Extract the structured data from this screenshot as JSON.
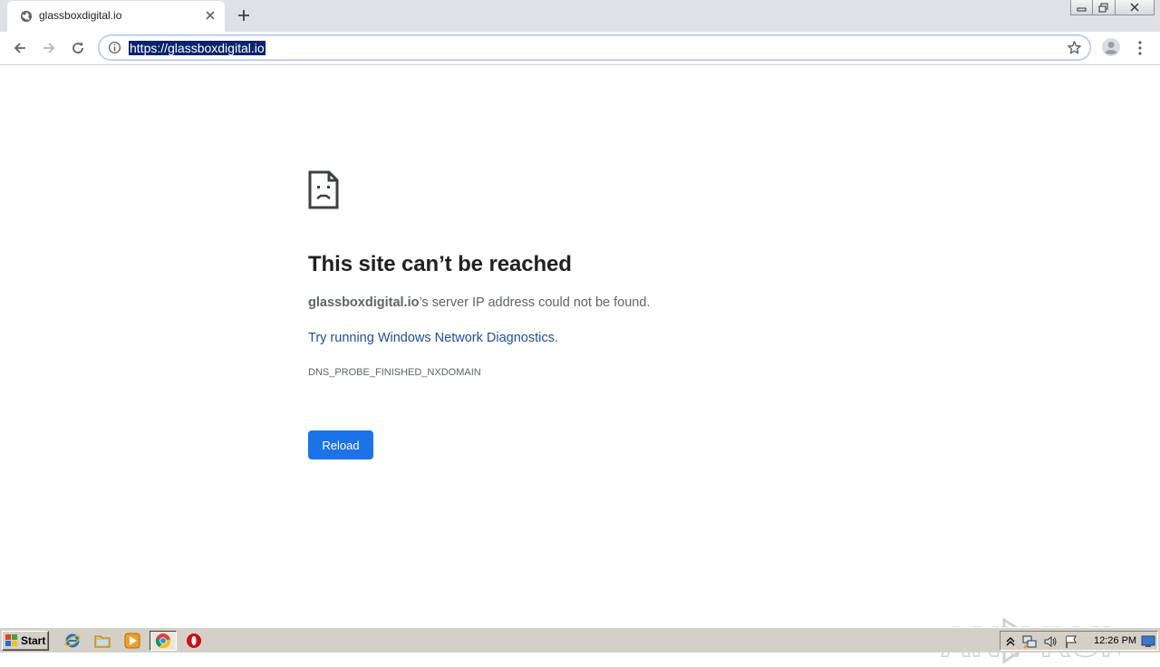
{
  "browser": {
    "tab": {
      "title": "glassboxdigital.io",
      "favicon": "globe-icon"
    },
    "omnibox": {
      "url": "https://glassboxdigital.io",
      "selected": true
    },
    "window_controls": [
      "minimize-icon",
      "restore-icon",
      "close-icon"
    ]
  },
  "error_page": {
    "heading": "This site can’t be reached",
    "host": "glassboxdigital.io",
    "description_suffix": "’s server IP address could not be found.",
    "diagnostics_link": "Try running Windows Network Diagnostics",
    "diagnostics_link_end": ".",
    "error_code": "DNS_PROBE_FINISHED_NXDOMAIN",
    "reload_label": "Reload",
    "accent_color": "#1a73e8"
  },
  "watermark": {
    "text": "ANY RUN"
  },
  "taskbar": {
    "start_label": "Start",
    "pinned": [
      "internet-explorer-icon",
      "folder-icon",
      "media-player-icon",
      "chrome-icon",
      "opera-icon"
    ],
    "tray": [
      "show-hidden-icons-icon",
      "network-icon",
      "volume-icon",
      "action-center-flag-icon",
      "show-desktop-icon"
    ],
    "clock": "12:26 PM"
  }
}
